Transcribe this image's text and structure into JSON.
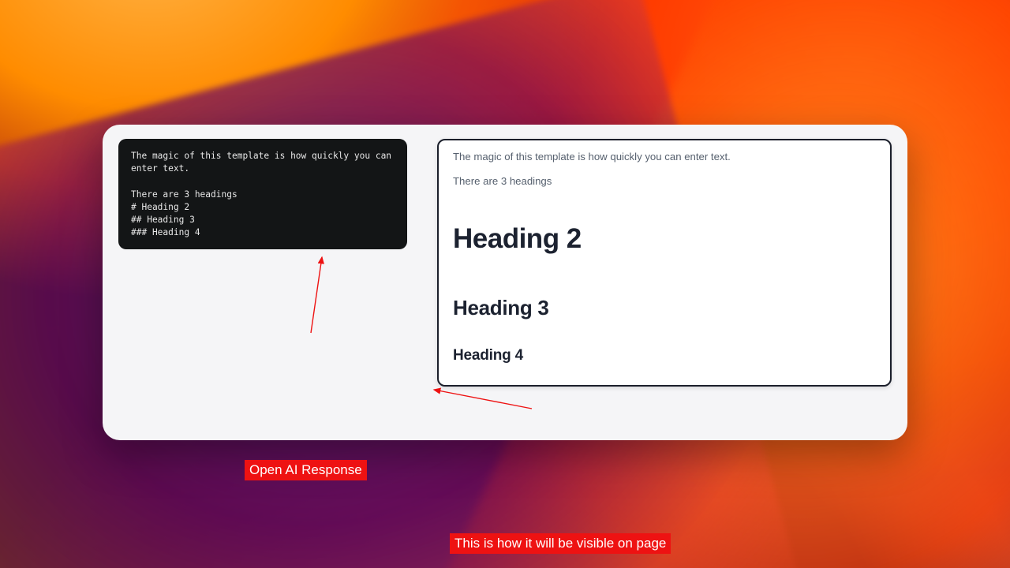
{
  "raw": {
    "text": "The magic of this template is how quickly you can enter text.\n\nThere are 3 headings\n# Heading 2\n## Heading 3\n### Heading 4"
  },
  "preview": {
    "intro": "The magic of this template is how quickly you can enter text.",
    "sub": "There are 3 headings",
    "h2": "Heading 2",
    "h3": "Heading 3",
    "h4": "Heading 4"
  },
  "annotations": {
    "left": "Open AI Response",
    "right": "This is how it will be visible on page"
  }
}
